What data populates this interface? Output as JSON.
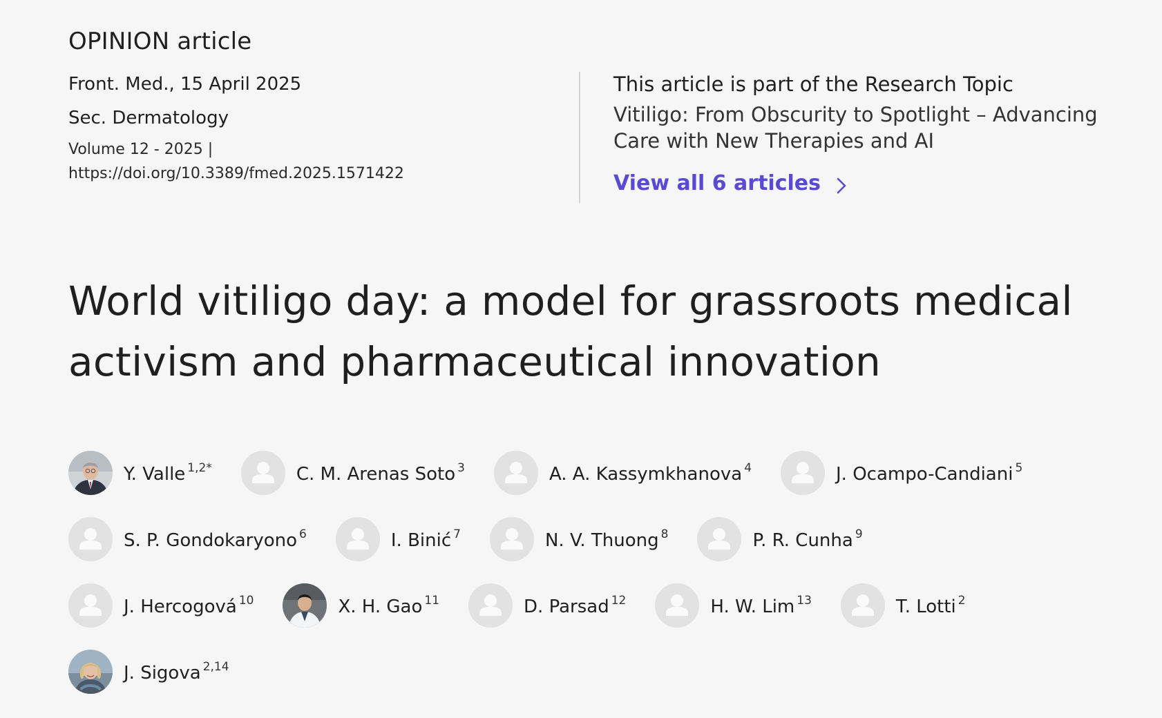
{
  "article_type": "OPINION article",
  "meta": {
    "date": "Front. Med., 15 April 2025",
    "section": "Sec. Dermatology",
    "volume": "Volume 12 - 2025 |",
    "doi": "https://doi.org/10.3389/fmed.2025.1571422"
  },
  "research_topic": {
    "intro": "This article is part of the Research Topic",
    "title": "Vitiligo: From Obscurity to Spotlight – Advancing Care with New Therapies and AI",
    "view_all": "View all 6 articles"
  },
  "title": "World vitiligo day: a model for grassroots medical activism and pharmaceutical innovation",
  "authors": [
    {
      "name": "Y. Valle",
      "sup": "1,2*",
      "avatar": "photo-man-gray-hair"
    },
    {
      "name": "C. M. Arenas Soto",
      "sup": "3",
      "avatar": "placeholder"
    },
    {
      "name": "A. A. Kassymkhanova",
      "sup": "4",
      "avatar": "placeholder"
    },
    {
      "name": "J. Ocampo-Candiani",
      "sup": "5",
      "avatar": "placeholder"
    },
    {
      "name": "S. P. Gondokaryono",
      "sup": "6",
      "avatar": "placeholder"
    },
    {
      "name": "I. Binić",
      "sup": "7",
      "avatar": "placeholder"
    },
    {
      "name": "N. V. Thuong",
      "sup": "8",
      "avatar": "placeholder"
    },
    {
      "name": "P. R. Cunha",
      "sup": "9",
      "avatar": "placeholder"
    },
    {
      "name": "J. Hercogová",
      "sup": "10",
      "avatar": "placeholder"
    },
    {
      "name": "X. H. Gao",
      "sup": "11",
      "avatar": "photo-man-white-coat"
    },
    {
      "name": "D. Parsad",
      "sup": "12",
      "avatar": "placeholder"
    },
    {
      "name": "H. W. Lim",
      "sup": "13",
      "avatar": "placeholder"
    },
    {
      "name": "T. Lotti",
      "sup": "2",
      "avatar": "placeholder"
    },
    {
      "name": "J. Sigova",
      "sup": "2,14",
      "avatar": "photo-woman-blonde"
    }
  ],
  "colors": {
    "background": "#f6f6f6",
    "text": "#1f1f1f",
    "accent_link": "#5a4ad1",
    "avatar_placeholder": "#e2e2e2",
    "divider": "#d4d4d4"
  }
}
